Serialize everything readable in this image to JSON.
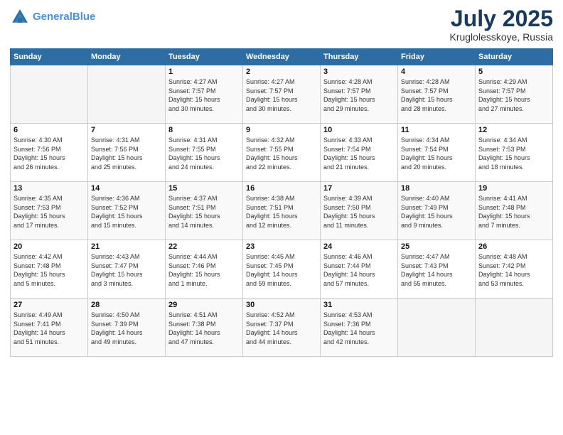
{
  "header": {
    "logo_line1": "General",
    "logo_line2": "Blue",
    "month": "July 2025",
    "location": "Kruglolesskoye, Russia"
  },
  "weekdays": [
    "Sunday",
    "Monday",
    "Tuesday",
    "Wednesday",
    "Thursday",
    "Friday",
    "Saturday"
  ],
  "weeks": [
    [
      {
        "day": "",
        "info": ""
      },
      {
        "day": "",
        "info": ""
      },
      {
        "day": "1",
        "info": "Sunrise: 4:27 AM\nSunset: 7:57 PM\nDaylight: 15 hours\nand 30 minutes."
      },
      {
        "day": "2",
        "info": "Sunrise: 4:27 AM\nSunset: 7:57 PM\nDaylight: 15 hours\nand 30 minutes."
      },
      {
        "day": "3",
        "info": "Sunrise: 4:28 AM\nSunset: 7:57 PM\nDaylight: 15 hours\nand 29 minutes."
      },
      {
        "day": "4",
        "info": "Sunrise: 4:28 AM\nSunset: 7:57 PM\nDaylight: 15 hours\nand 28 minutes."
      },
      {
        "day": "5",
        "info": "Sunrise: 4:29 AM\nSunset: 7:57 PM\nDaylight: 15 hours\nand 27 minutes."
      }
    ],
    [
      {
        "day": "6",
        "info": "Sunrise: 4:30 AM\nSunset: 7:56 PM\nDaylight: 15 hours\nand 26 minutes."
      },
      {
        "day": "7",
        "info": "Sunrise: 4:31 AM\nSunset: 7:56 PM\nDaylight: 15 hours\nand 25 minutes."
      },
      {
        "day": "8",
        "info": "Sunrise: 4:31 AM\nSunset: 7:55 PM\nDaylight: 15 hours\nand 24 minutes."
      },
      {
        "day": "9",
        "info": "Sunrise: 4:32 AM\nSunset: 7:55 PM\nDaylight: 15 hours\nand 22 minutes."
      },
      {
        "day": "10",
        "info": "Sunrise: 4:33 AM\nSunset: 7:54 PM\nDaylight: 15 hours\nand 21 minutes."
      },
      {
        "day": "11",
        "info": "Sunrise: 4:34 AM\nSunset: 7:54 PM\nDaylight: 15 hours\nand 20 minutes."
      },
      {
        "day": "12",
        "info": "Sunrise: 4:34 AM\nSunset: 7:53 PM\nDaylight: 15 hours\nand 18 minutes."
      }
    ],
    [
      {
        "day": "13",
        "info": "Sunrise: 4:35 AM\nSunset: 7:53 PM\nDaylight: 15 hours\nand 17 minutes."
      },
      {
        "day": "14",
        "info": "Sunrise: 4:36 AM\nSunset: 7:52 PM\nDaylight: 15 hours\nand 15 minutes."
      },
      {
        "day": "15",
        "info": "Sunrise: 4:37 AM\nSunset: 7:51 PM\nDaylight: 15 hours\nand 14 minutes."
      },
      {
        "day": "16",
        "info": "Sunrise: 4:38 AM\nSunset: 7:51 PM\nDaylight: 15 hours\nand 12 minutes."
      },
      {
        "day": "17",
        "info": "Sunrise: 4:39 AM\nSunset: 7:50 PM\nDaylight: 15 hours\nand 11 minutes."
      },
      {
        "day": "18",
        "info": "Sunrise: 4:40 AM\nSunset: 7:49 PM\nDaylight: 15 hours\nand 9 minutes."
      },
      {
        "day": "19",
        "info": "Sunrise: 4:41 AM\nSunset: 7:48 PM\nDaylight: 15 hours\nand 7 minutes."
      }
    ],
    [
      {
        "day": "20",
        "info": "Sunrise: 4:42 AM\nSunset: 7:48 PM\nDaylight: 15 hours\nand 5 minutes."
      },
      {
        "day": "21",
        "info": "Sunrise: 4:43 AM\nSunset: 7:47 PM\nDaylight: 15 hours\nand 3 minutes."
      },
      {
        "day": "22",
        "info": "Sunrise: 4:44 AM\nSunset: 7:46 PM\nDaylight: 15 hours\nand 1 minute."
      },
      {
        "day": "23",
        "info": "Sunrise: 4:45 AM\nSunset: 7:45 PM\nDaylight: 14 hours\nand 59 minutes."
      },
      {
        "day": "24",
        "info": "Sunrise: 4:46 AM\nSunset: 7:44 PM\nDaylight: 14 hours\nand 57 minutes."
      },
      {
        "day": "25",
        "info": "Sunrise: 4:47 AM\nSunset: 7:43 PM\nDaylight: 14 hours\nand 55 minutes."
      },
      {
        "day": "26",
        "info": "Sunrise: 4:48 AM\nSunset: 7:42 PM\nDaylight: 14 hours\nand 53 minutes."
      }
    ],
    [
      {
        "day": "27",
        "info": "Sunrise: 4:49 AM\nSunset: 7:41 PM\nDaylight: 14 hours\nand 51 minutes."
      },
      {
        "day": "28",
        "info": "Sunrise: 4:50 AM\nSunset: 7:39 PM\nDaylight: 14 hours\nand 49 minutes."
      },
      {
        "day": "29",
        "info": "Sunrise: 4:51 AM\nSunset: 7:38 PM\nDaylight: 14 hours\nand 47 minutes."
      },
      {
        "day": "30",
        "info": "Sunrise: 4:52 AM\nSunset: 7:37 PM\nDaylight: 14 hours\nand 44 minutes."
      },
      {
        "day": "31",
        "info": "Sunrise: 4:53 AM\nSunset: 7:36 PM\nDaylight: 14 hours\nand 42 minutes."
      },
      {
        "day": "",
        "info": ""
      },
      {
        "day": "",
        "info": ""
      }
    ]
  ]
}
